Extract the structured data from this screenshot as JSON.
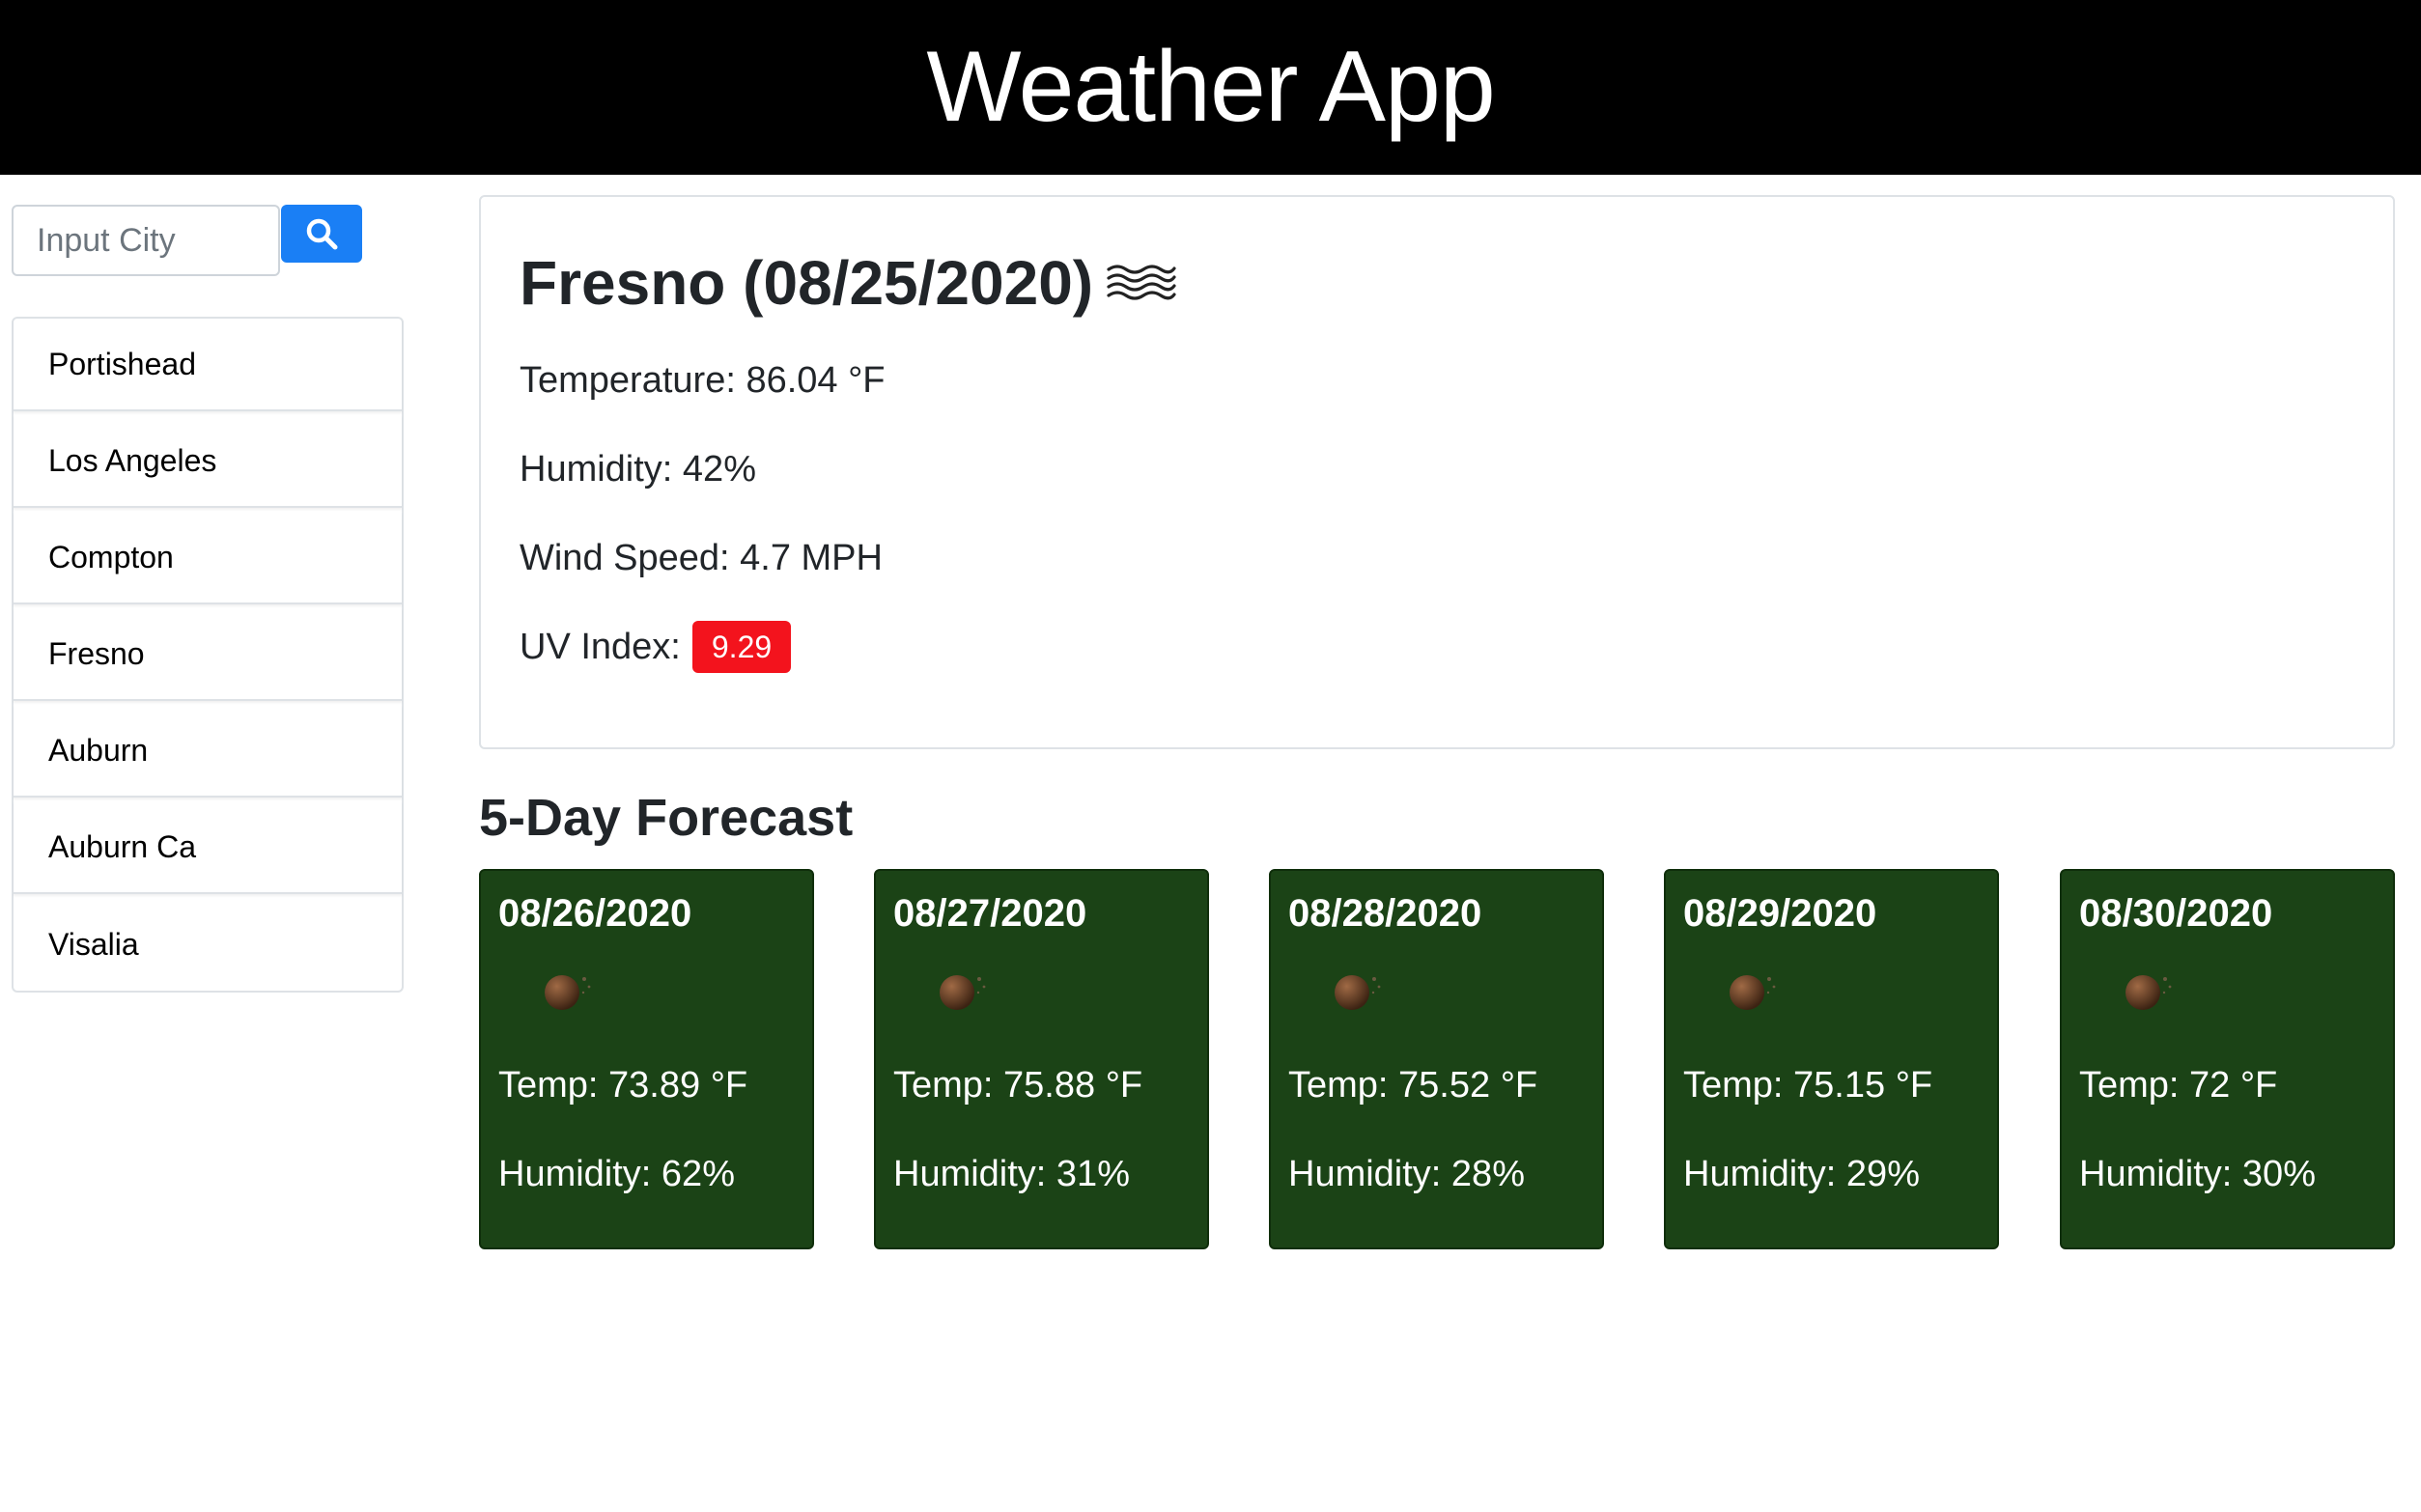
{
  "header": {
    "title": "Weather App"
  },
  "search": {
    "placeholder": "Input City",
    "value": "",
    "button_icon": "search-icon"
  },
  "history": [
    {
      "label": "Portishead"
    },
    {
      "label": "Los Angeles"
    },
    {
      "label": "Compton"
    },
    {
      "label": "Fresno"
    },
    {
      "label": "Auburn"
    },
    {
      "label": "Auburn Ca"
    },
    {
      "label": "Visalia"
    }
  ],
  "current": {
    "title": "Fresno (08/25/2020)",
    "icon": "haze-icon",
    "temperature": "Temperature: 86.04 °F",
    "humidity": "Humidity: 42%",
    "wind": "Wind Speed: 4.7 MPH",
    "uv_label": "UV Index:",
    "uv_value": "9.29"
  },
  "forecast": {
    "heading": "5-Day Forecast",
    "days": [
      {
        "date": "08/26/2020",
        "icon": "clear-night-icon",
        "temp": "Temp: 73.89 °F",
        "humidity": "Humidity: 62%"
      },
      {
        "date": "08/27/2020",
        "icon": "clear-night-icon",
        "temp": "Temp: 75.88 °F",
        "humidity": "Humidity: 31%"
      },
      {
        "date": "08/28/2020",
        "icon": "clear-night-icon",
        "temp": "Temp: 75.52 °F",
        "humidity": "Humidity: 28%"
      },
      {
        "date": "08/29/2020",
        "icon": "clear-night-icon",
        "temp": "Temp: 75.15 °F",
        "humidity": "Humidity: 29%"
      },
      {
        "date": "08/30/2020",
        "icon": "clear-night-icon",
        "temp": "Temp: 72 °F",
        "humidity": "Humidity: 30%"
      }
    ]
  },
  "colors": {
    "header_bg": "#000000",
    "search_button": "#1a7ff5",
    "uv_high": "#f3131d",
    "forecast_card": "#1b4316"
  }
}
